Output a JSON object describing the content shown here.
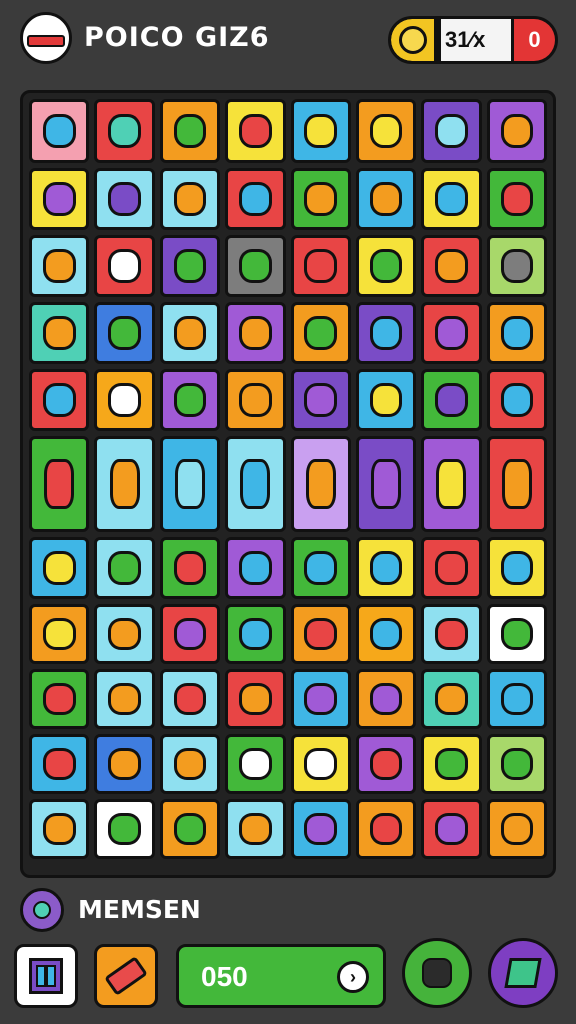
{
  "header": {
    "title": "POICO GIZ6",
    "score": "31⁄x",
    "lives": "0"
  },
  "board": {
    "rows": [
      [
        "#f4a0b0",
        "#e84545",
        "#f39c1f",
        "#f6e23a",
        "#3fb6e6",
        "#f39c1f",
        "#7a4cc6",
        "#a05ad6"
      ],
      [
        "#f6e23a",
        "#8fe0f0",
        "#8fe0f0",
        "#e84545",
        "#43b83a",
        "#3fb6e6",
        "#f6e23a",
        "#43b83a"
      ],
      [
        "#8fe0f0",
        "#e84545",
        "#7a4cc6",
        "#7d7d7d",
        "#e84545",
        "#f6e23a",
        "#e84545",
        "#a8d86a"
      ],
      [
        "#4fd0b5",
        "#3f7de0",
        "#8fe0f0",
        "#a05ad6",
        "#f39c1f",
        "#7a4cc6",
        "#e84545",
        "#f39c1f"
      ],
      [
        "#e84545",
        "#f6a81a",
        "#a05ad6",
        "#f39c1f",
        "#7a4cc6",
        "#3fb6e6",
        "#43b83a",
        "#e84545"
      ],
      [
        "#43b83a",
        "#8fe0f0",
        "#3fb6e6",
        "#8fe0f0",
        "#c9a0f0",
        "#7a4cc6",
        "#a05ad6",
        "#e84545"
      ],
      [
        "#3fb6e6",
        "#8fe0f0",
        "#43b83a",
        "#a05ad6",
        "#43b83a",
        "#f6e23a",
        "#e84545",
        "#f6e23a"
      ],
      [
        "#f39c1f",
        "#8fe0f0",
        "#e84545",
        "#43b83a",
        "#f39c1f",
        "#f6a81a",
        "#8fe0f0",
        "#ffffff"
      ],
      [
        "#43b83a",
        "#8fe0f0",
        "#8fe0f0",
        "#e84545",
        "#3fb6e6",
        "#f39c1f",
        "#4fd0b5",
        "#3fb6e6"
      ],
      [
        "#3fb6e6",
        "#3f7de0",
        "#8fe0f0",
        "#43b83a",
        "#f6e23a",
        "#a05ad6",
        "#f6e23a",
        "#a8d86a"
      ],
      [
        "#8fe0f0",
        "#ffffff",
        "#f39c1f",
        "#8fe0f0",
        "#3fb6e6",
        "#f39c1f",
        "#e84545",
        "#f39c1f"
      ]
    ],
    "glyph_colors": [
      [
        "#3fb6e6",
        "#4fd0b5",
        "#43b83a",
        "#e84545",
        "#f6e23a",
        "#f6e23a",
        "#8fe0f0",
        "#f39c1f"
      ],
      [
        "#a05ad6",
        "#7a4cc6",
        "#f39c1f",
        "#3fb6e6",
        "#f39c1f",
        "#f39c1f",
        "#3fb6e6",
        "#e84545"
      ],
      [
        "#f39c1f",
        "#ffffff",
        "#43b83a",
        "#43b83a",
        "#e84545",
        "#43b83a",
        "#f39c1f",
        "#7d7d7d"
      ],
      [
        "#f39c1f",
        "#43b83a",
        "#f39c1f",
        "#f39c1f",
        "#43b83a",
        "#3fb6e6",
        "#a05ad6",
        "#3fb6e6"
      ],
      [
        "#3fb6e6",
        "#ffffff",
        "#43b83a",
        "#f39c1f",
        "#a05ad6",
        "#f6e23a",
        "#7a4cc6",
        "#3fb6e6"
      ],
      [
        "#e84545",
        "#f39c1f",
        "#8fe0f0",
        "#3fb6e6",
        "#f39c1f",
        "#a05ad6",
        "#f6e23a",
        "#f39c1f"
      ],
      [
        "#f6e23a",
        "#43b83a",
        "#e84545",
        "#3fb6e6",
        "#3fb6e6",
        "#3fb6e6",
        "#e84545",
        "#3fb6e6"
      ],
      [
        "#f6e23a",
        "#f39c1f",
        "#a05ad6",
        "#3fb6e6",
        "#e84545",
        "#3fb6e6",
        "#e84545",
        "#43b83a"
      ],
      [
        "#e84545",
        "#f39c1f",
        "#e84545",
        "#f39c1f",
        "#a05ad6",
        "#a05ad6",
        "#f39c1f",
        "#3fb6e6"
      ],
      [
        "#e84545",
        "#f39c1f",
        "#f39c1f",
        "#ffffff",
        "#ffffff",
        "#e84545",
        "#43b83a",
        "#43b83a"
      ],
      [
        "#f39c1f",
        "#43b83a",
        "#43b83a",
        "#f39c1f",
        "#a05ad6",
        "#e84545",
        "#a05ad6",
        "#f39c1f"
      ]
    ]
  },
  "footer": {
    "player_name": "MEMSEN",
    "progress_value": "050",
    "go_label": "›"
  },
  "icons": {
    "logo": "flag-logo-icon",
    "coin": "coin-icon",
    "profile": "avatar-icon",
    "menu": "columns-icon",
    "eraser": "eraser-icon",
    "go": "arrow-right-icon",
    "puzzle": "puzzle-icon",
    "map": "map-icon"
  }
}
